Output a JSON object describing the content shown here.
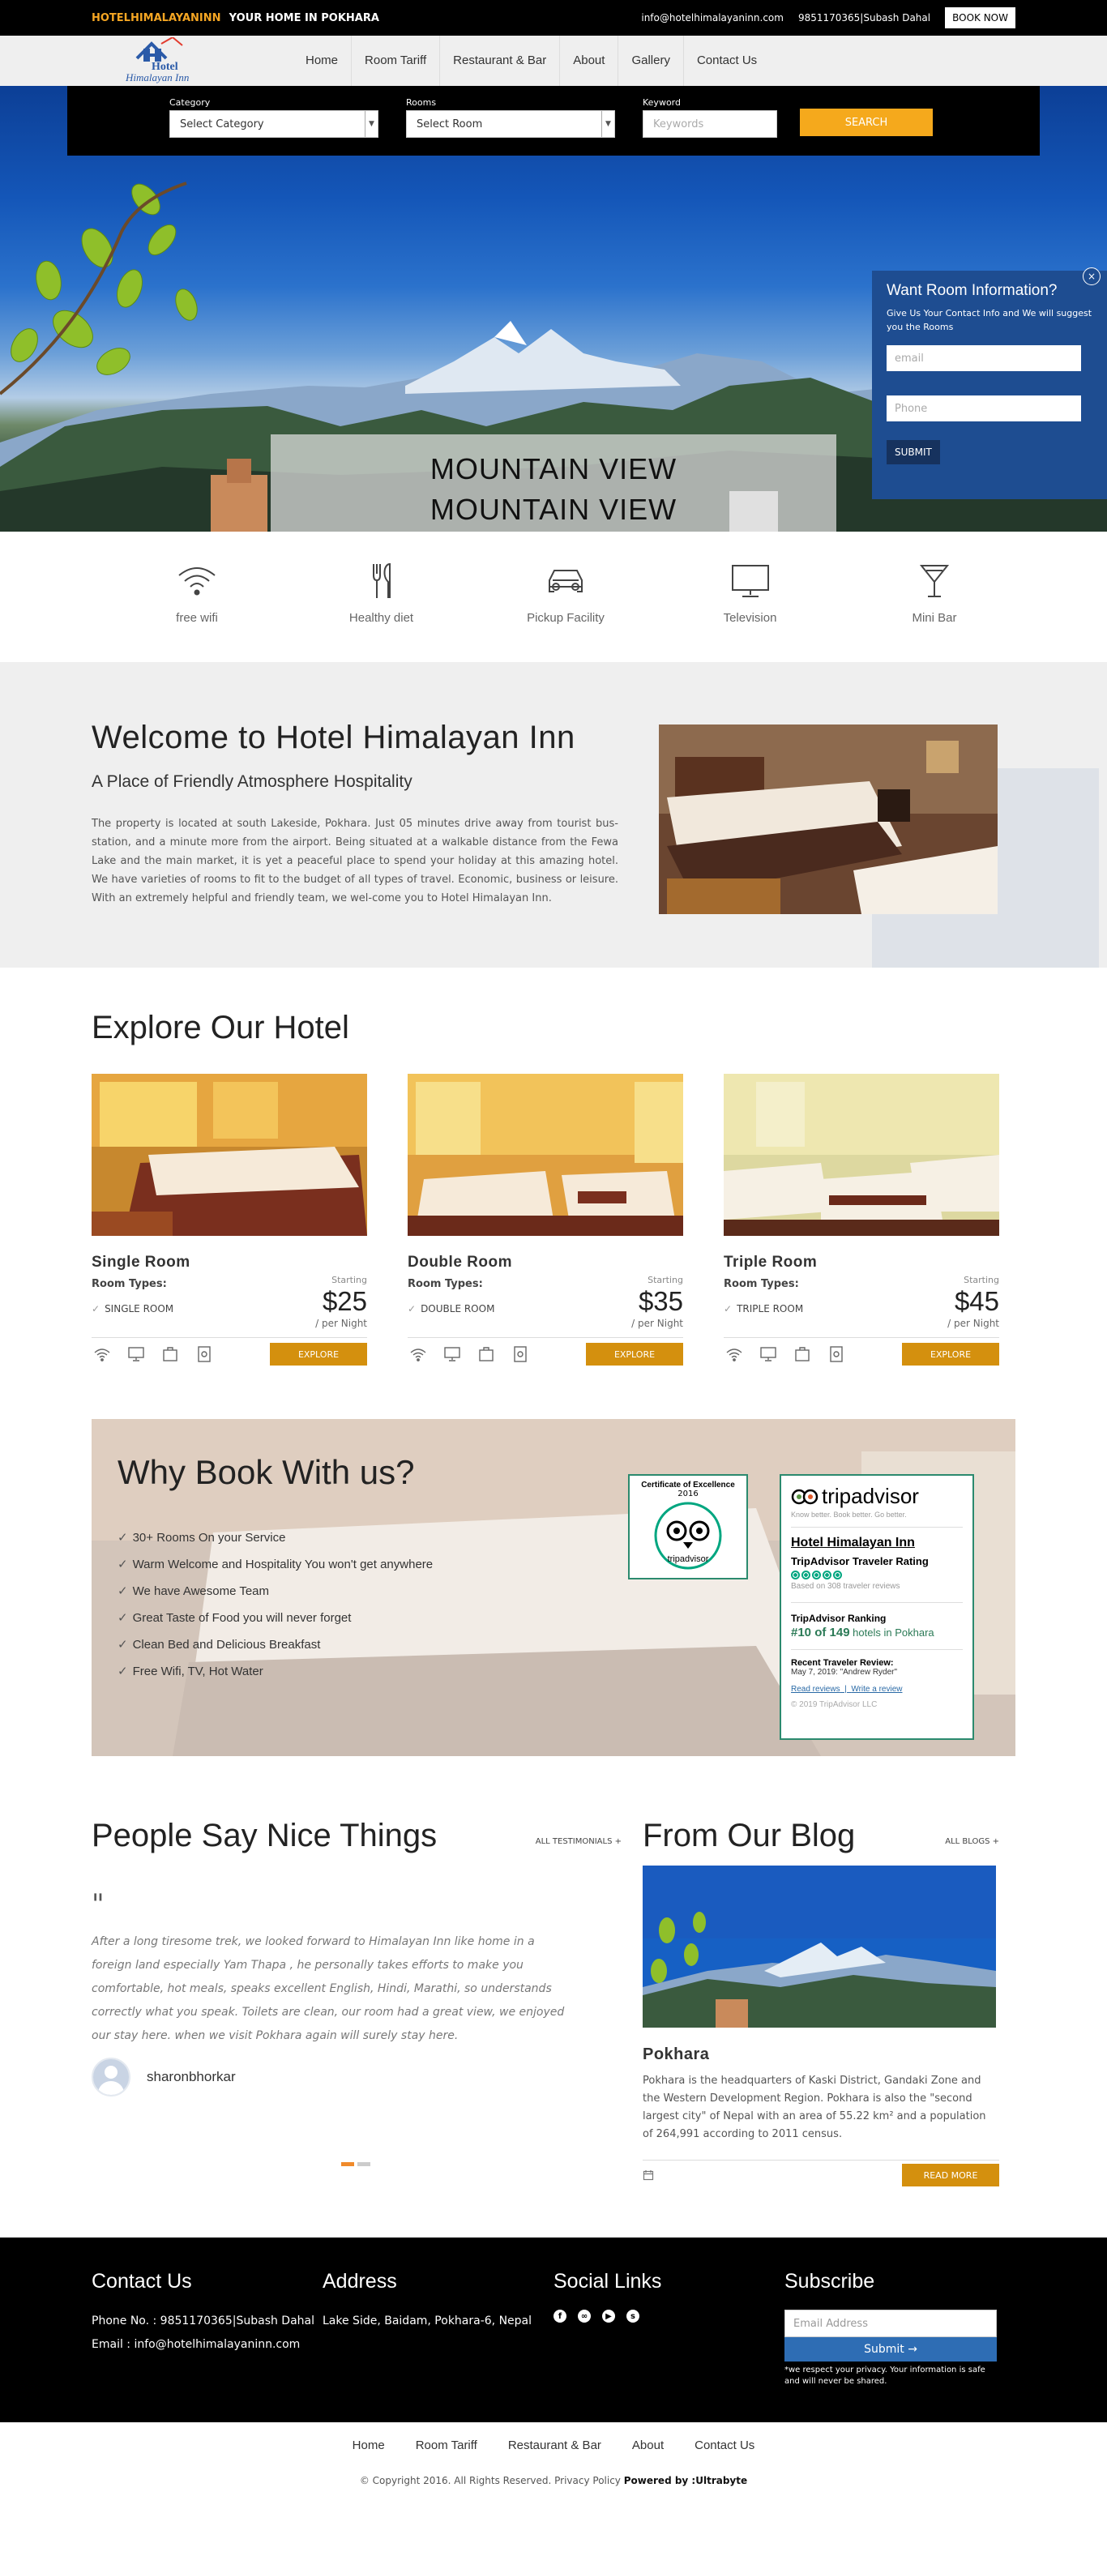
{
  "topbar": {
    "brand_name": "HOTELHIMALAYANINN",
    "brand_tag": "YOUR HOME IN POKHARA",
    "email": "info@hotelhimalayaninn.com",
    "phone": "9851170365|Subash Dahal",
    "book_now": "BOOK NOW"
  },
  "logo": {
    "line1": "Hotel",
    "line2": "Himalayan Inn"
  },
  "nav": [
    "Home",
    "Room Tariff",
    "Restaurant & Bar",
    "About",
    "Gallery",
    "Contact Us"
  ],
  "search": {
    "category_label": "Category",
    "category_value": "Select Category",
    "rooms_label": "Rooms",
    "rooms_value": "Select Room",
    "keyword_label": "Keyword",
    "keyword_placeholder": "Keywords",
    "button": "SEARCH"
  },
  "hero": {
    "caption_line1": "MOUNTAIN VIEW",
    "caption_line2": "MOUNTAIN VIEW"
  },
  "room_info": {
    "title": "Want Room Information?",
    "text": "Give Us Your Contact Info and We will suggest you the Rooms",
    "email_placeholder": "email",
    "phone_placeholder": "Phone",
    "submit": "SUBMIT",
    "close": "×"
  },
  "amenities": [
    {
      "label": "free wifi",
      "icon": "wifi-icon"
    },
    {
      "label": "Healthy diet",
      "icon": "cutlery-icon"
    },
    {
      "label": "Pickup Facility",
      "icon": "car-icon"
    },
    {
      "label": "Television",
      "icon": "television-icon"
    },
    {
      "label": "Mini Bar",
      "icon": "cocktail-icon"
    }
  ],
  "welcome": {
    "title": "Welcome to Hotel Himalayan Inn",
    "subtitle": "A Place of Friendly Atmosphere Hospitality",
    "body": "The property is located at south Lakeside, Pokhara. Just 05 minutes drive away from tourist bus-station, and a minute more from the airport. Being situated at a walkable distance from the Fewa Lake and the main market, it is yet a peaceful place to spend your holiday at this amazing hotel. We have varieties of rooms to fit to the budget of all types of travel. Economic, business or leisure. With an extremely helpful and friendly team, we wel-come you to Hotel Himalayan Inn."
  },
  "explore": {
    "title": "Explore Our Hotel",
    "room_types_label": "Room Types:",
    "starting_label": "Starting",
    "per_night": "/ per Night",
    "button": "EXPLORE",
    "rooms": [
      {
        "name": "Single Room",
        "type": "SINGLE ROOM",
        "price": "$25"
      },
      {
        "name": "Double Room",
        "type": "DOUBLE ROOM",
        "price": "$35"
      },
      {
        "name": "Triple Room",
        "type": "TRIPLE ROOM",
        "price": "$45"
      }
    ]
  },
  "why": {
    "title": "Why Book With us?",
    "items": [
      "30+ Rooms On your Service",
      "Warm Welcome and Hospitality You won't get anywhere",
      "We have Awesome Team",
      "Great Taste of Food you will never forget",
      "Clean Bed and Delicious Breakfast",
      "Free Wifi, TV, Hot Water"
    ],
    "certificate": {
      "title": "Certificate of Excellence",
      "year": "2016",
      "brand": "tripadvisor"
    },
    "tripadvisor": {
      "logo": "tripadvisor",
      "tagline": "Know better. Book better. Go better.",
      "hotel_name": "Hotel Himalayan Inn",
      "rating_label": "TripAdvisor Traveler Rating",
      "based_on": "Based on 308 traveler reviews",
      "ranking_label": "TripAdvisor Ranking",
      "ranking_value": "#10 of 149",
      "ranking_suffix": "hotels in Pokhara",
      "recent_label": "Recent Traveler Review:",
      "recent_review": "May 7, 2019: \"Andrew Ryder\"",
      "read_reviews": "Read reviews",
      "write_review": "Write a review",
      "copyright": "© 2019 TripAdvisor LLC"
    }
  },
  "testimonials": {
    "title": "People Say Nice Things",
    "all_link": "ALL TESTIMONIALS +",
    "quote_mark": "\"",
    "text": "After a long tiresome trek, we looked forward to Himalayan Inn like home in a foreign land especially Yam Thapa , he personally takes efforts to make you comfortable, hot meals, speaks excellent English, Hindi, Marathi, so understands correctly what you speak. Toilets are clean, our room had a great view, we enjoyed our stay here. when we visit Pokhara again will surely stay here.",
    "author": "sharonbhorkar"
  },
  "blog": {
    "title": "From Our Blog",
    "all_link": "ALL BLOGS +",
    "post_title": "Pokhara",
    "post_text": "Pokhara is the headquarters of Kaski District, Gandaki Zone and the Western Development Region. Pokhara is also the \"second largest city\" of Nepal with an area of 55.22 km² and a population of 264,991 according to 2011 census.",
    "read_more": "READ MORE"
  },
  "footer": {
    "contact_title": "Contact Us",
    "contact_phone": "Phone No. : 9851170365|Subash Dahal",
    "contact_email": "Email : info@hotelhimalayaninn.com",
    "address_title": "Address",
    "address": "Lake Side, Baidam, Pokhara-6, Nepal",
    "social_title": "Social Links",
    "subscribe_title": "Subscribe",
    "email_placeholder": "Email Address",
    "submit": "Submit →",
    "note": "*we respect your privacy. Your information is safe and will never be shared."
  },
  "bottom_nav": [
    "Home",
    "Room Tariff",
    "Restaurant & Bar",
    "About",
    "Contact Us"
  ],
  "copyright": {
    "text": "© Copyright 2016. All Rights Reserved. Privacy Policy",
    "powered": "Powered by :Ultrabyte"
  },
  "colors": {
    "accent": "#f5a623",
    "button_orange": "#d4900e",
    "info_blue": "#1e4d91",
    "tripadvisor_green": "#00a680"
  }
}
